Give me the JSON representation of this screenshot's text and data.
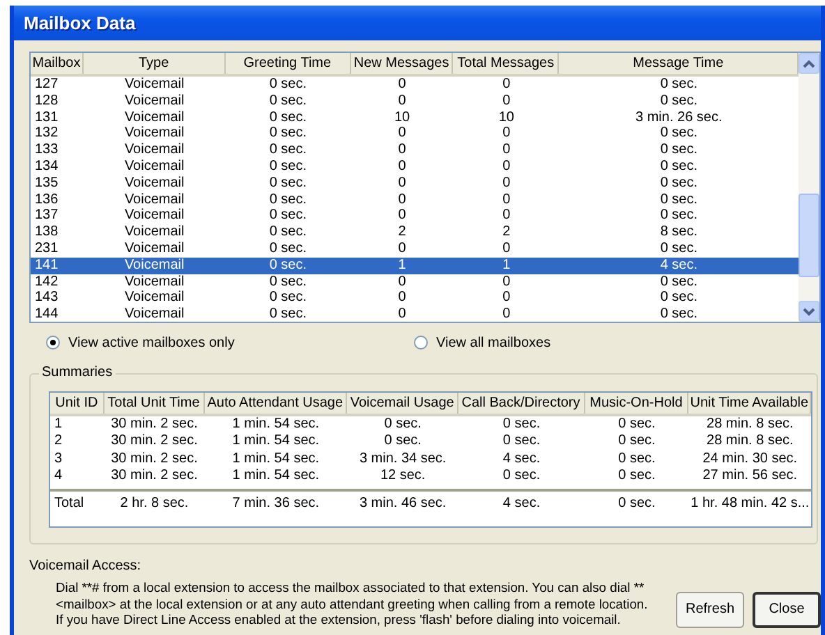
{
  "window": {
    "title": "Mailbox Data"
  },
  "mailboxes": {
    "columns": [
      "Mailbox",
      "Type",
      "Greeting Time",
      "New Messages",
      "Total Messages",
      "Message Time"
    ],
    "rows": [
      {
        "cells": [
          "127",
          "Voicemail",
          "0 sec.",
          "0",
          "0",
          "0 sec."
        ],
        "selected": false
      },
      {
        "cells": [
          "128",
          "Voicemail",
          "0 sec.",
          "0",
          "0",
          "0 sec."
        ],
        "selected": false
      },
      {
        "cells": [
          "131",
          "Voicemail",
          "0 sec.",
          "10",
          "10",
          "3 min. 26 sec."
        ],
        "selected": false
      },
      {
        "cells": [
          "132",
          "Voicemail",
          "0 sec.",
          "0",
          "0",
          "0 sec."
        ],
        "selected": false
      },
      {
        "cells": [
          "133",
          "Voicemail",
          "0 sec.",
          "0",
          "0",
          "0 sec."
        ],
        "selected": false
      },
      {
        "cells": [
          "134",
          "Voicemail",
          "0 sec.",
          "0",
          "0",
          "0 sec."
        ],
        "selected": false
      },
      {
        "cells": [
          "135",
          "Voicemail",
          "0 sec.",
          "0",
          "0",
          "0 sec."
        ],
        "selected": false
      },
      {
        "cells": [
          "136",
          "Voicemail",
          "0 sec.",
          "0",
          "0",
          "0 sec."
        ],
        "selected": false
      },
      {
        "cells": [
          "137",
          "Voicemail",
          "0 sec.",
          "0",
          "0",
          "0 sec."
        ],
        "selected": false
      },
      {
        "cells": [
          "138",
          "Voicemail",
          "0 sec.",
          "2",
          "2",
          "8 sec."
        ],
        "selected": false
      },
      {
        "cells": [
          "231",
          "Voicemail",
          "0 sec.",
          "0",
          "0",
          "0 sec."
        ],
        "selected": false
      },
      {
        "cells": [
          "141",
          "Voicemail",
          "0 sec.",
          "1",
          "1",
          "4 sec."
        ],
        "selected": true
      },
      {
        "cells": [
          "142",
          "Voicemail",
          "0 sec.",
          "0",
          "0",
          "0 sec."
        ],
        "selected": false
      },
      {
        "cells": [
          "143",
          "Voicemail",
          "0 sec.",
          "0",
          "0",
          "0 sec."
        ],
        "selected": false
      },
      {
        "cells": [
          "144",
          "Voicemail",
          "0 sec.",
          "0",
          "0",
          "0 sec."
        ],
        "selected": false
      }
    ]
  },
  "view_options": [
    {
      "label": "View active mailboxes only",
      "selected": true
    },
    {
      "label": "View all mailboxes",
      "selected": false
    }
  ],
  "summaries": {
    "title": "Summaries",
    "columns": [
      "Unit ID",
      "Total Unit Time",
      "Auto Attendant Usage",
      "Voicemail Usage",
      "Call Back/Directory",
      "Music-On-Hold",
      "Unit Time Available"
    ],
    "rows": [
      [
        "1",
        "30 min. 2 sec.",
        "1 min. 54 sec.",
        "0 sec.",
        "0 sec.",
        "0 sec.",
        "28 min. 8 sec."
      ],
      [
        "2",
        "30 min. 2 sec.",
        "1 min. 54 sec.",
        "0 sec.",
        "0 sec.",
        "0 sec.",
        "28 min. 8 sec."
      ],
      [
        "3",
        "30 min. 2 sec.",
        "1 min. 54 sec.",
        "3 min. 34 sec.",
        "4 sec.",
        "0 sec.",
        "24 min. 30 sec."
      ],
      [
        "4",
        "30 min. 2 sec.",
        "1 min. 54 sec.",
        "12 sec.",
        "0 sec.",
        "0 sec.",
        "27 min. 56 sec."
      ]
    ],
    "total": [
      "Total",
      "2 hr. 8 sec.",
      "7 min. 36 sec.",
      "3 min. 46 sec.",
      "4 sec.",
      "0 sec.",
      "1 hr. 48 min. 42 s..."
    ]
  },
  "voicemail_access": {
    "label": "Voicemail Access:",
    "lines": [
      "Dial **# from a local extension to access the mailbox associated to that extension. You can also dial **",
      "<mailbox> at the local extension or at any auto attendant greeting when calling from a remote location.",
      "If you have Direct Line Access enabled at the extension, press 'flash' before dialing into voicemail."
    ]
  },
  "buttons": [
    "Refresh",
    "Close"
  ]
}
